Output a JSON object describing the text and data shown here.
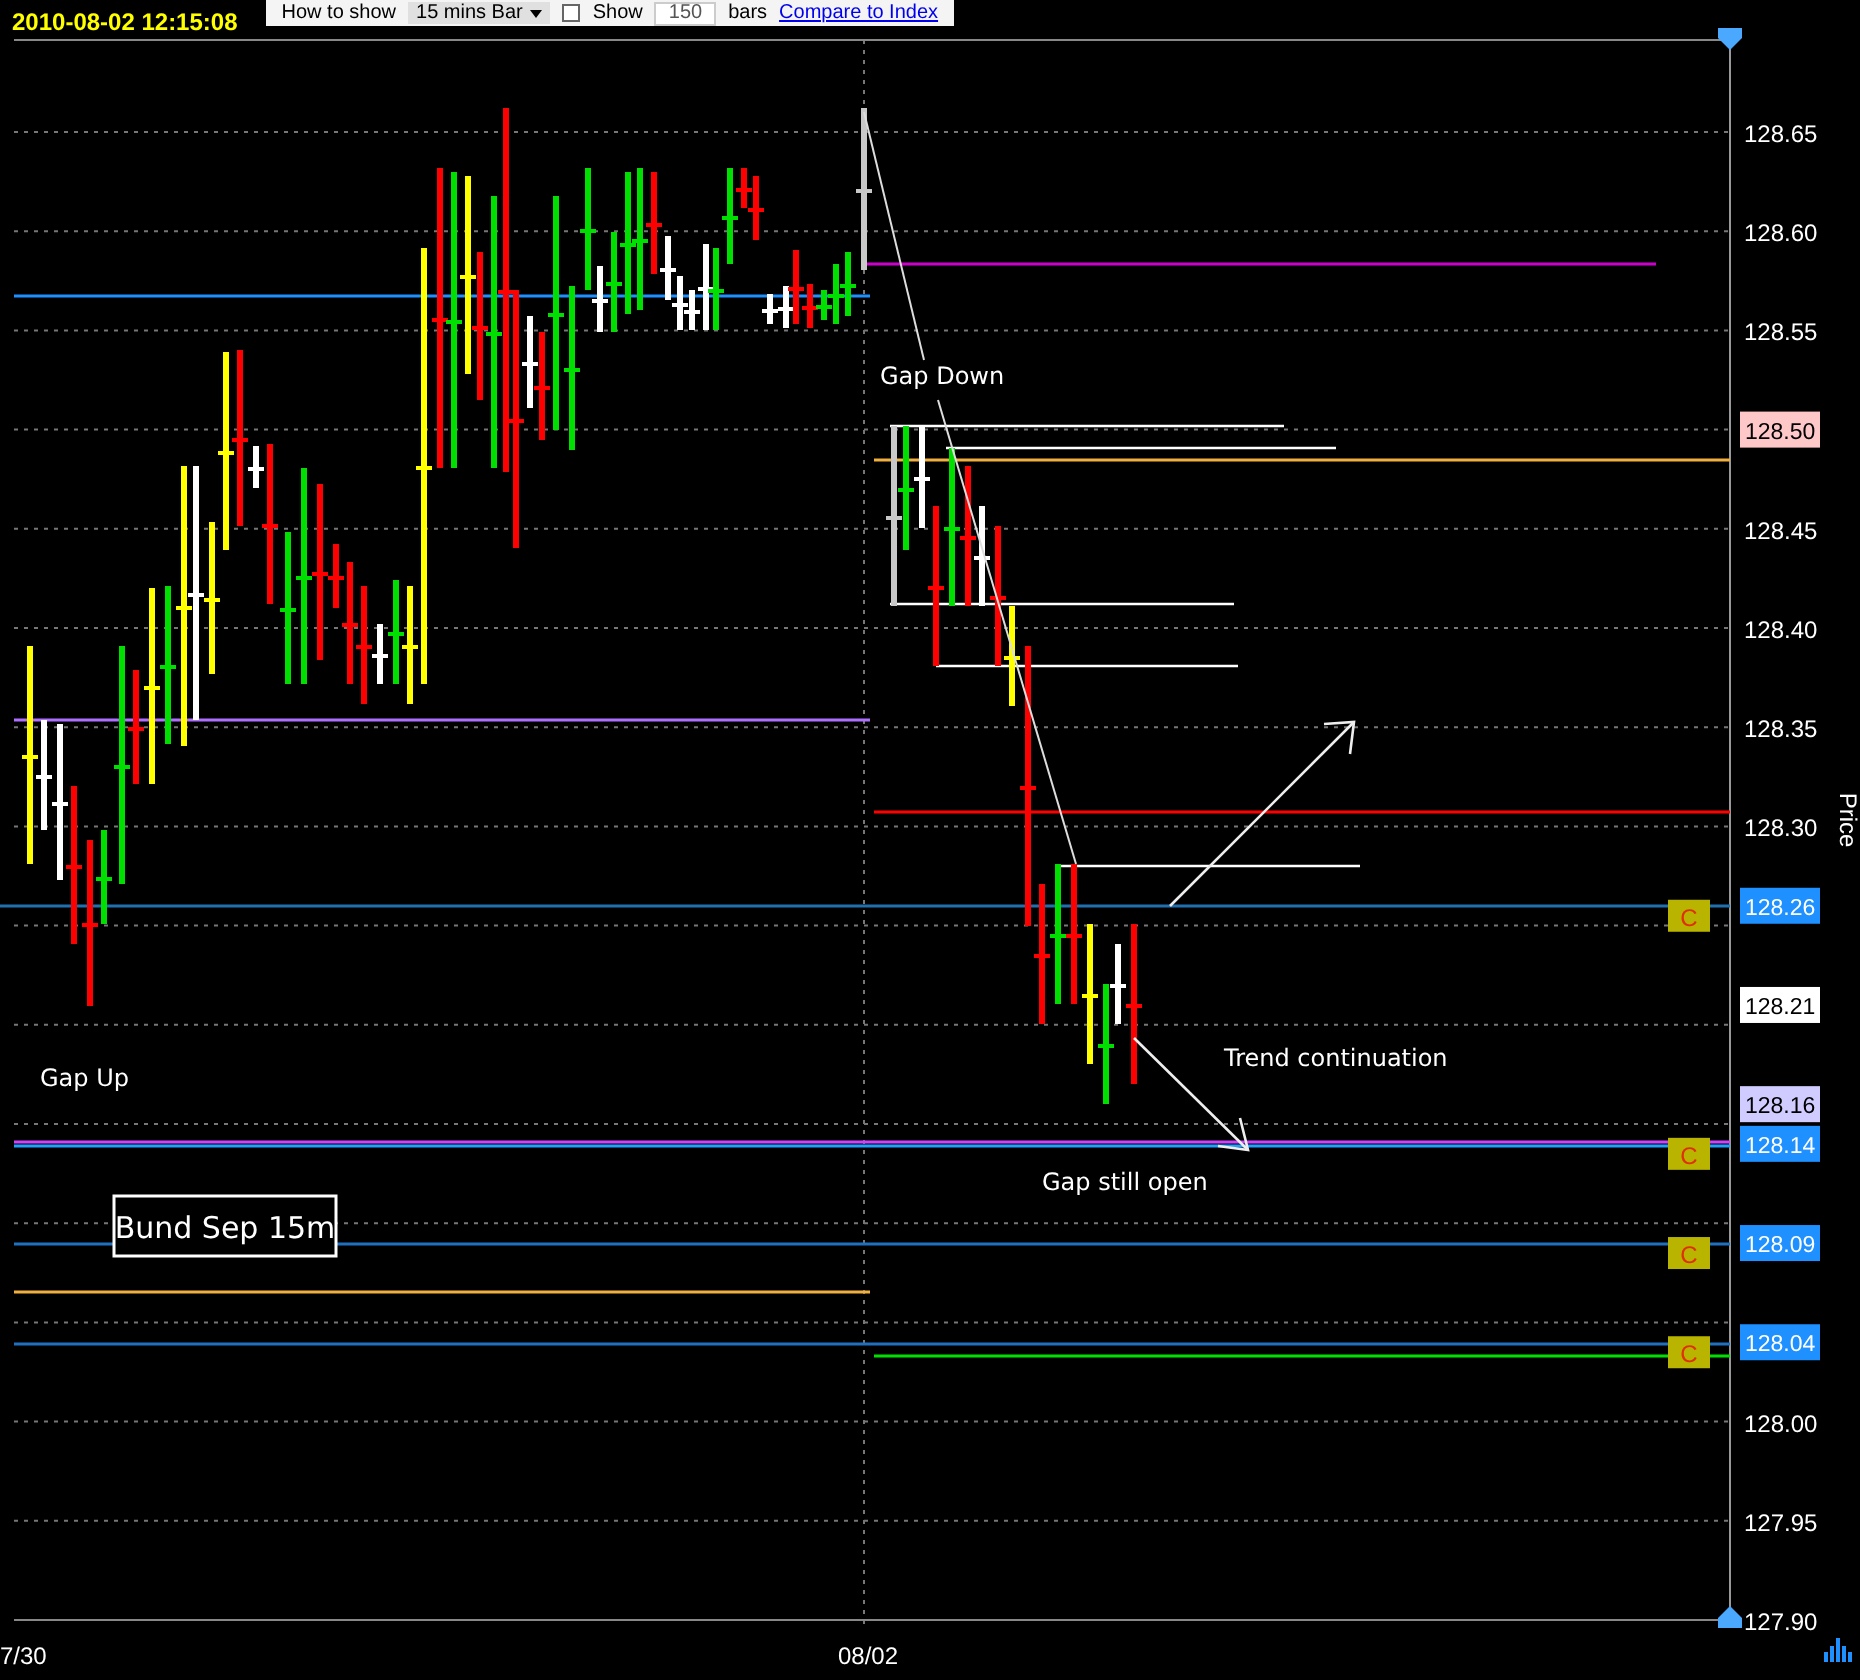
{
  "toolbar": {
    "timestamp": "2010-08-02 12:15:08",
    "show_label": "How to show",
    "interval": "15 mins Bar",
    "show_checkbox": {
      "label": "Show",
      "checked": false
    },
    "bars_count": "150",
    "bars_label": "bars",
    "compare_link": "Compare to Index"
  },
  "chart": {
    "title": "Bund Sep 15m",
    "y_axis_label": "Price",
    "y_ticks": [
      "128.65",
      "128.60",
      "128.55",
      "128.45",
      "128.40",
      "128.35",
      "128.30",
      "128.00",
      "127.95",
      "127.90"
    ],
    "x_labels": [
      "7/30",
      "08/02"
    ],
    "price_tags": [
      {
        "text": "128.50",
        "kind": "alert"
      },
      {
        "text": "128.26",
        "kind": "line",
        "marker": "C"
      },
      {
        "text": "128.21",
        "kind": "last"
      },
      {
        "text": "128.16",
        "kind": "bid"
      },
      {
        "text": "128.14",
        "kind": "line",
        "marker": "C"
      },
      {
        "text": "128.09",
        "kind": "line",
        "marker": "C"
      },
      {
        "text": "128.04",
        "kind": "line",
        "marker": "C"
      }
    ],
    "annotations": [
      "Gap Up",
      "Gap Down",
      "Trend continuation",
      "Gap still open"
    ]
  }
}
